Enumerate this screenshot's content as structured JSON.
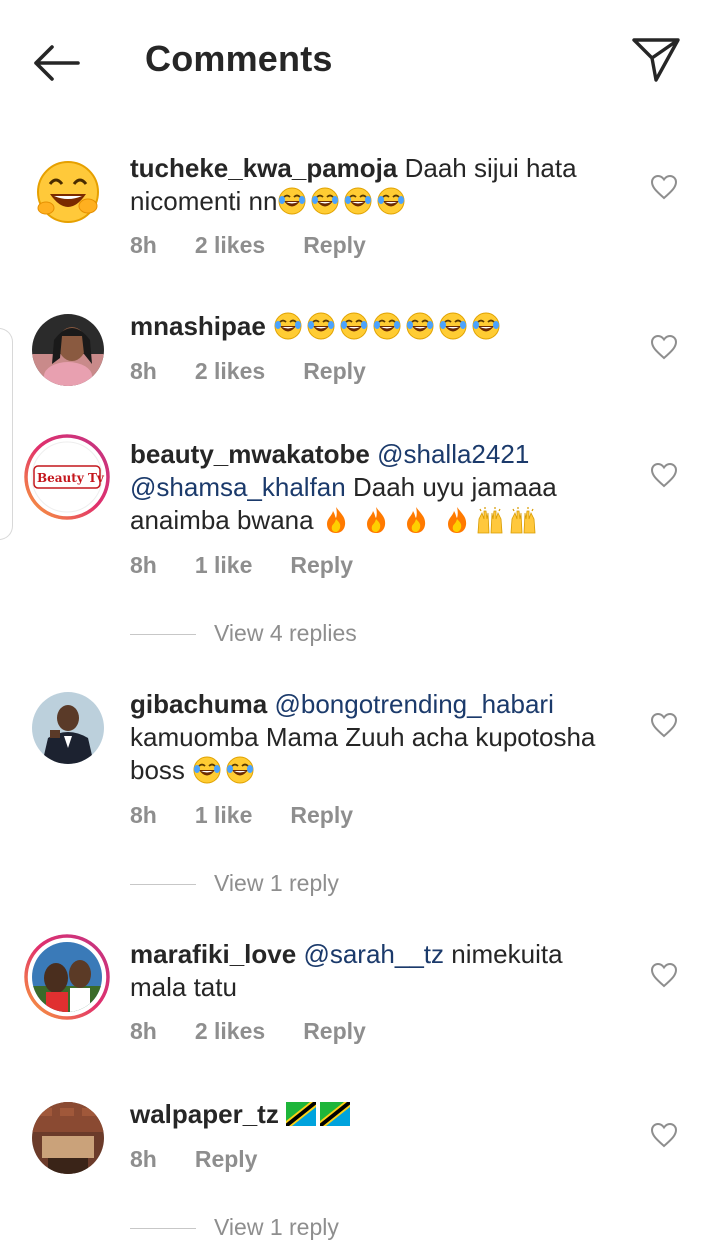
{
  "header": {
    "title": "Comments",
    "back_icon": "arrow-left-icon",
    "send_icon": "paper-plane-icon"
  },
  "comments": [
    {
      "username": "tucheke_kwa_pamoja",
      "text_before": " Daah sijui hata nicomenti nn",
      "time": "8h",
      "likes": "2 likes",
      "reply": "Reply"
    },
    {
      "username": "mnashipae",
      "time": "8h",
      "likes": "2 likes",
      "reply": "Reply"
    },
    {
      "username": "beauty_mwakatobe",
      "mention1": "@shalla2421",
      "mention2": "@shamsa_khalfan",
      "text": " Daah uyu jamaaa anaimba bwana ",
      "avatar_text": "Beauty Tv",
      "time": "8h",
      "likes": "1 like",
      "reply": "Reply",
      "view_replies": "View 4 replies"
    },
    {
      "username": "gibachuma",
      "mention1": "@bongotrending_habari",
      "text": "kamuomba Mama Zuuh acha kupotosha boss ",
      "time": "8h",
      "likes": "1 like",
      "reply": "Reply",
      "view_replies": "View 1 reply"
    },
    {
      "username": "marafiki_love",
      "mention1": "@sarah__tz",
      "text": "  nimekuita mala tatu",
      "time": "8h",
      "likes": "2 likes",
      "reply": "Reply"
    },
    {
      "username": "walpaper_tz",
      "time": "8h",
      "reply": "Reply",
      "view_replies": "View 1 reply"
    }
  ],
  "colors": {
    "text": "#262626",
    "muted": "#8e8e8e",
    "mention": "#1b3a6b",
    "story_ring": "#e1306c"
  }
}
